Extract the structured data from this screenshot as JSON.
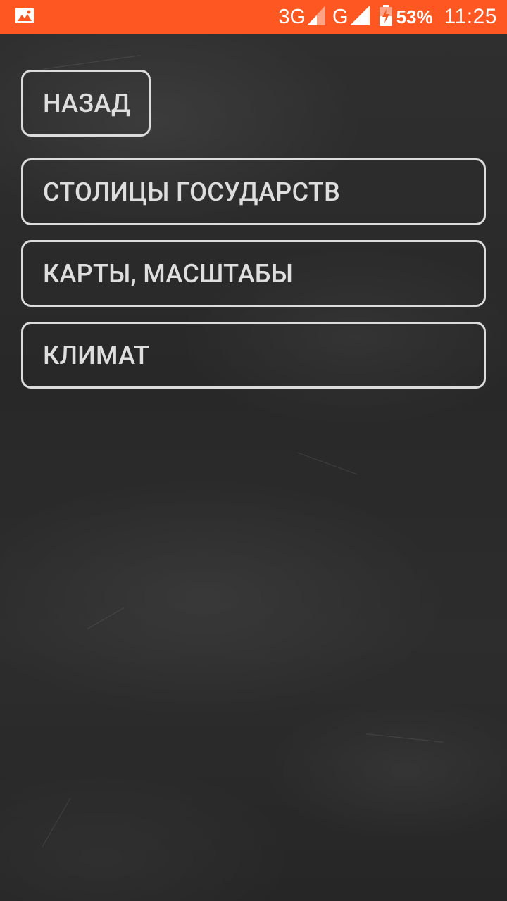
{
  "status_bar": {
    "notification_icon": "image-icon",
    "network_1": "3G",
    "network_2": "G",
    "battery_icon": "battery-charging-icon",
    "battery_percent": "53%",
    "time": "11:25",
    "color": "#ff5722"
  },
  "navigation": {
    "back_label": "НАЗАД"
  },
  "categories": [
    {
      "label": "СТОЛИЦЫ ГОСУДАРСТВ"
    },
    {
      "label": "КАРТЫ, МАСШТАБЫ"
    },
    {
      "label": "КЛИМАТ"
    }
  ],
  "theme": {
    "background": "#2b2b2b",
    "button_border": "#dcdcdc",
    "button_text": "#dedede"
  }
}
